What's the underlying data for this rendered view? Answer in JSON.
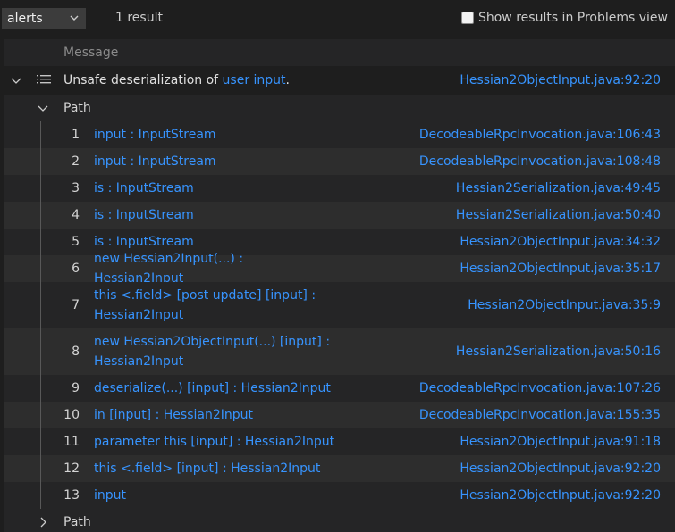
{
  "toolbar": {
    "select_value": "alerts",
    "result_count": "1 result",
    "show_problems_label": "Show results in Problems view"
  },
  "table": {
    "header_label": "Message",
    "alert": {
      "text_before": "Unsafe deserialization of ",
      "link_text": "user input",
      "text_after": ".",
      "location": "Hessian2ObjectInput.java:92:20"
    },
    "path_label": "Path",
    "collapsed_path_label": "Path",
    "steps": [
      {
        "num": "1",
        "expr": "input : InputStream",
        "loc": "DecodeableRpcInvocation.java:106:43"
      },
      {
        "num": "2",
        "expr": "input : InputStream",
        "loc": "DecodeableRpcInvocation.java:108:48"
      },
      {
        "num": "3",
        "expr": "is : InputStream",
        "loc": "Hessian2Serialization.java:49:45"
      },
      {
        "num": "4",
        "expr": "is : InputStream",
        "loc": "Hessian2Serialization.java:50:40"
      },
      {
        "num": "5",
        "expr": "is : InputStream",
        "loc": "Hessian2ObjectInput.java:34:32"
      },
      {
        "num": "6",
        "expr": "new Hessian2Input(...) : Hessian2Input",
        "loc": "Hessian2ObjectInput.java:35:17"
      },
      {
        "num": "7",
        "expr": "this <.field> [post update] [input] : Hessian2Input",
        "loc": "Hessian2ObjectInput.java:35:9"
      },
      {
        "num": "8",
        "expr": "new Hessian2ObjectInput(...) [input] : Hessian2Input",
        "loc": "Hessian2Serialization.java:50:16"
      },
      {
        "num": "9",
        "expr": "deserialize(...) [input] : Hessian2Input",
        "loc": "DecodeableRpcInvocation.java:107:26"
      },
      {
        "num": "10",
        "expr": "in [input] : Hessian2Input",
        "loc": "DecodeableRpcInvocation.java:155:35"
      },
      {
        "num": "11",
        "expr": "parameter this [input] : Hessian2Input",
        "loc": "Hessian2ObjectInput.java:91:18"
      },
      {
        "num": "12",
        "expr": "this <.field> [input] : Hessian2Input",
        "loc": "Hessian2ObjectInput.java:92:20"
      },
      {
        "num": "13",
        "expr": "input",
        "loc": "Hessian2ObjectInput.java:92:20"
      }
    ]
  }
}
